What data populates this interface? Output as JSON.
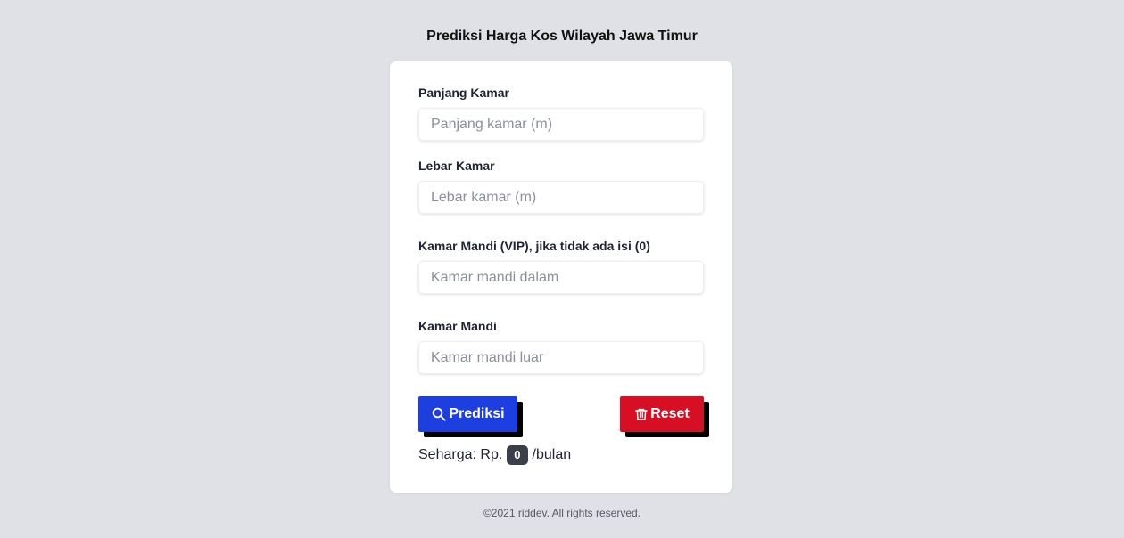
{
  "header": {
    "title": "Prediksi Harga Kos Wilayah Jawa Timur"
  },
  "form": {
    "fields": [
      {
        "label": "Panjang Kamar",
        "placeholder": "Panjang kamar (m)",
        "value": ""
      },
      {
        "label": "Lebar Kamar",
        "placeholder": "Lebar kamar (m)",
        "value": ""
      },
      {
        "label": "Kamar Mandi (VIP), jika tidak ada isi (0)",
        "placeholder": "Kamar mandi dalam",
        "value": ""
      },
      {
        "label": "Kamar Mandi",
        "placeholder": "Kamar mandi luar",
        "value": ""
      }
    ],
    "predict_button": {
      "label": "Prediksi",
      "icon": "search-icon",
      "color": "#1d3fe0"
    },
    "reset_button": {
      "label": "Reset",
      "icon": "trash-icon",
      "color": "#d70f24"
    }
  },
  "result": {
    "prefix": "Seharga: Rp.",
    "value": "0",
    "suffix": "/bulan"
  },
  "footer": {
    "text": "©2021 riddev. All rights reserved."
  }
}
